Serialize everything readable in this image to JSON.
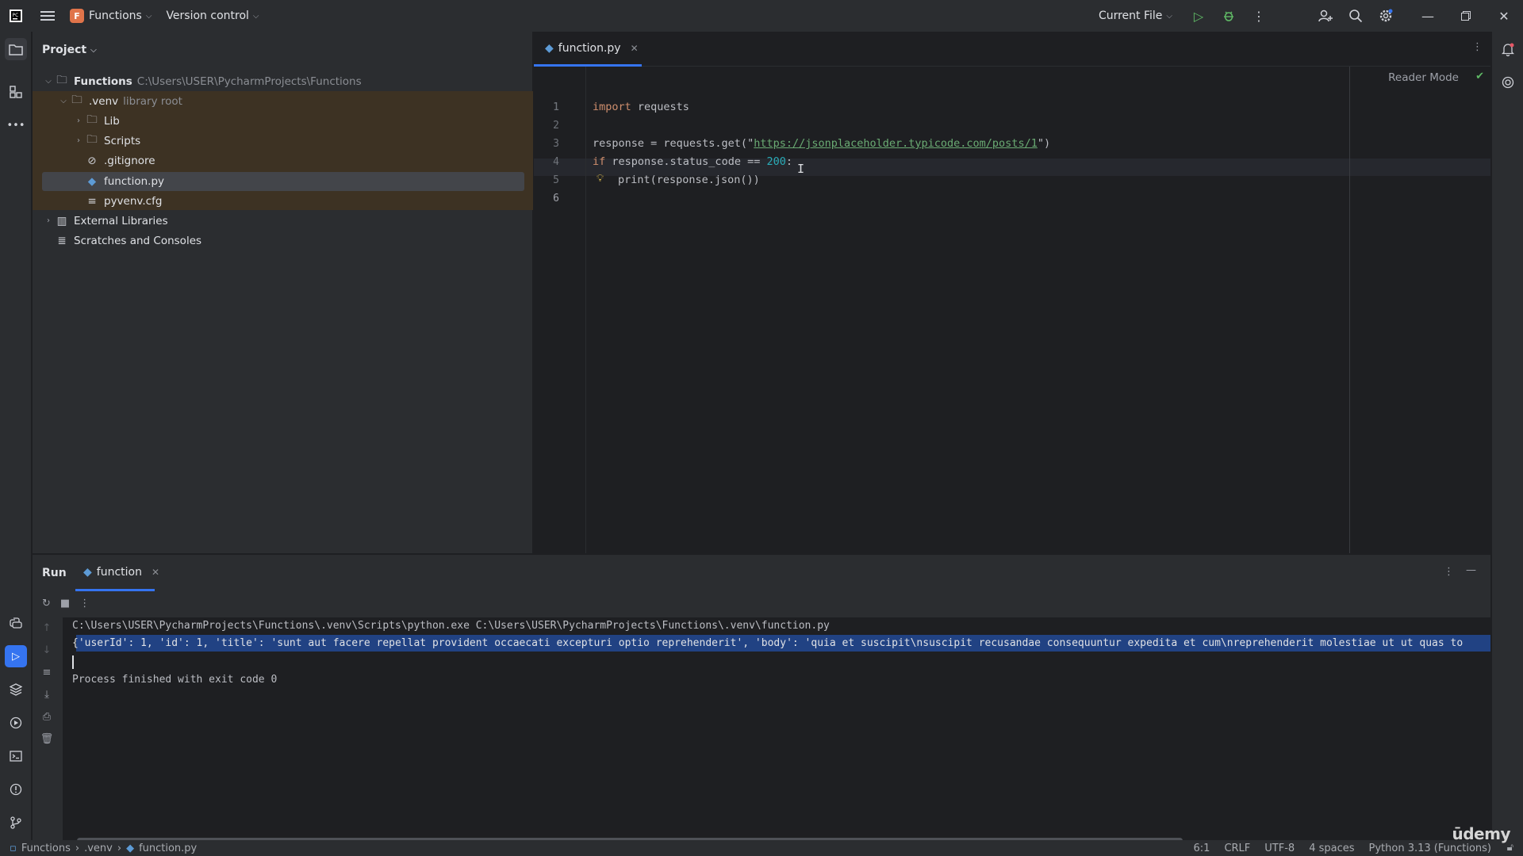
{
  "titlebar": {
    "project_badge": "F",
    "project_name": "Functions",
    "version_control": "Version control",
    "run_config": "Current File"
  },
  "project_panel": {
    "title": "Project",
    "tree": [
      {
        "label": "Functions",
        "hint": "C:\\Users\\USER\\PycharmProjects\\Functions"
      },
      {
        "label": ".venv",
        "hint": "library root"
      },
      {
        "label": "Lib"
      },
      {
        "label": "Scripts"
      },
      {
        "label": ".gitignore"
      },
      {
        "label": "function.py"
      },
      {
        "label": "pyvenv.cfg"
      },
      {
        "label": "External Libraries"
      },
      {
        "label": "Scratches and Consoles"
      }
    ]
  },
  "editor": {
    "tab": "function.py",
    "reader_mode": "Reader Mode",
    "line_numbers": [
      "1",
      "2",
      "3",
      "4",
      "5",
      "6"
    ],
    "code": {
      "l1_kw": "import",
      "l1_rest": " requests",
      "l3_a": "response = requests.get(\"",
      "l3_url": "https://jsonplaceholder.typicode.com/posts/1",
      "l3_b": "\")",
      "l4_kw": "if",
      "l4_a": " response.status_code == ",
      "l4_num": "200",
      "l4_b": ":",
      "l5": "print(response.json())"
    }
  },
  "run_panel": {
    "title": "Run",
    "tab": "function",
    "lines": [
      "C:\\Users\\USER\\PycharmProjects\\Functions\\.venv\\Scripts\\python.exe C:\\Users\\USER\\PycharmProjects\\Functions\\.venv\\function.py",
      "{'userId': 1, 'id': 1, 'title': 'sunt aut facere repellat provident occaecati excepturi optio reprehenderit', 'body': 'quia et suscipit\\nsuscipit recusandae consequuntur expedita et cum\\nreprehenderit molestiae ut ut quas to",
      "Process finished with exit code 0"
    ]
  },
  "status_bar": {
    "breadcrumb": [
      "Functions",
      ".venv",
      "function.py"
    ],
    "position": "6:1",
    "line_sep": "CRLF",
    "encoding": "UTF-8",
    "indent": "4 spaces",
    "interpreter": "Python 3.13 (Functions)"
  },
  "watermark": "ūdemy",
  "colors": {
    "accent": "#3574f0",
    "venv_highlight": "#3d3223",
    "selection": "#214283"
  }
}
